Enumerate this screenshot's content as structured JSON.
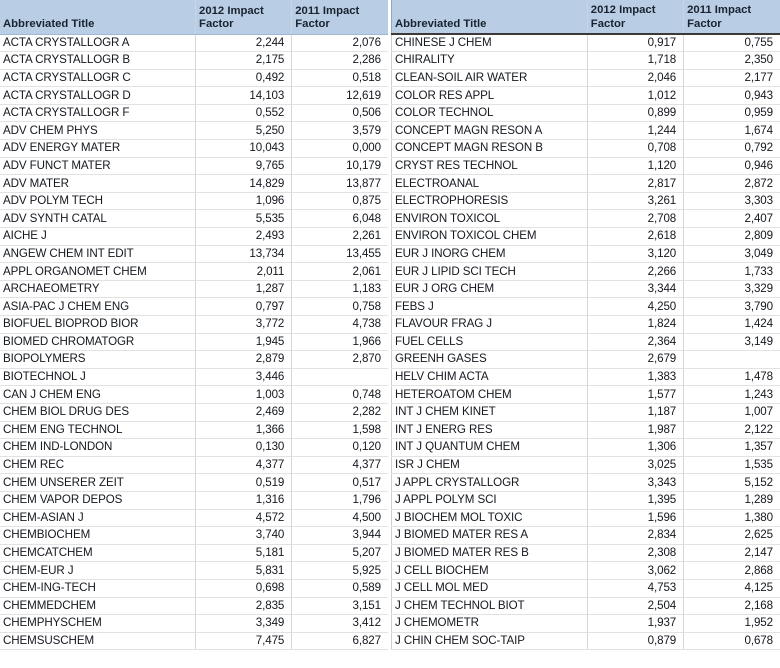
{
  "document": {
    "kind": "spreadsheet",
    "title": "Journal Impact Factor Table",
    "header_bg": "#b9cde4",
    "header_text_color": "#1a2330",
    "grid_line_color": "#d6d6d6",
    "decimal_separator": ","
  },
  "columns": {
    "title": "Abbreviated Title",
    "if2012": "2012 Impact\nFactor",
    "if2011": "2011 Impact\nFactor"
  },
  "left_table": {
    "rows": [
      {
        "title": "ACTA CRYSTALLOGR A",
        "if2012": "2,244",
        "if2011": "2,076"
      },
      {
        "title": "ACTA CRYSTALLOGR B",
        "if2012": "2,175",
        "if2011": "2,286"
      },
      {
        "title": "ACTA CRYSTALLOGR C",
        "if2012": "0,492",
        "if2011": "0,518"
      },
      {
        "title": "ACTA CRYSTALLOGR D",
        "if2012": "14,103",
        "if2011": "12,619"
      },
      {
        "title": "ACTA CRYSTALLOGR F",
        "if2012": "0,552",
        "if2011": "0,506"
      },
      {
        "title": "ADV CHEM PHYS",
        "if2012": "5,250",
        "if2011": "3,579"
      },
      {
        "title": "ADV ENERGY MATER",
        "if2012": "10,043",
        "if2011": "0,000"
      },
      {
        "title": "ADV FUNCT MATER",
        "if2012": "9,765",
        "if2011": "10,179"
      },
      {
        "title": "ADV MATER",
        "if2012": "14,829",
        "if2011": "13,877"
      },
      {
        "title": "ADV POLYM TECH",
        "if2012": "1,096",
        "if2011": "0,875"
      },
      {
        "title": "ADV SYNTH CATAL",
        "if2012": "5,535",
        "if2011": "6,048"
      },
      {
        "title": "AICHE J",
        "if2012": "2,493",
        "if2011": "2,261"
      },
      {
        "title": "ANGEW CHEM INT EDIT",
        "if2012": "13,734",
        "if2011": "13,455"
      },
      {
        "title": "APPL ORGANOMET CHEM",
        "if2012": "2,011",
        "if2011": "2,061"
      },
      {
        "title": "ARCHAEOMETRY",
        "if2012": "1,287",
        "if2011": "1,183"
      },
      {
        "title": "ASIA-PAC J CHEM ENG",
        "if2012": "0,797",
        "if2011": "0,758"
      },
      {
        "title": "BIOFUEL BIOPROD BIOR",
        "if2012": "3,772",
        "if2011": "4,738"
      },
      {
        "title": "BIOMED CHROMATOGR",
        "if2012": "1,945",
        "if2011": "1,966"
      },
      {
        "title": "BIOPOLYMERS",
        "if2012": "2,879",
        "if2011": "2,870"
      },
      {
        "title": "BIOTECHNOL J",
        "if2012": "3,446",
        "if2011": ""
      },
      {
        "title": "CAN J CHEM ENG",
        "if2012": "1,003",
        "if2011": "0,748"
      },
      {
        "title": "CHEM BIOL DRUG DES",
        "if2012": "2,469",
        "if2011": "2,282"
      },
      {
        "title": "CHEM ENG TECHNOL",
        "if2012": "1,366",
        "if2011": "1,598"
      },
      {
        "title": "CHEM IND-LONDON",
        "if2012": "0,130",
        "if2011": "0,120"
      },
      {
        "title": "CHEM REC",
        "if2012": "4,377",
        "if2011": "4,377"
      },
      {
        "title": "CHEM UNSERER ZEIT",
        "if2012": "0,519",
        "if2011": "0,517"
      },
      {
        "title": "CHEM VAPOR DEPOS",
        "if2012": "1,316",
        "if2011": "1,796"
      },
      {
        "title": "CHEM-ASIAN J",
        "if2012": "4,572",
        "if2011": "4,500"
      },
      {
        "title": "CHEMBIOCHEM",
        "if2012": "3,740",
        "if2011": "3,944"
      },
      {
        "title": "CHEMCATCHEM",
        "if2012": "5,181",
        "if2011": "5,207"
      },
      {
        "title": "CHEM-EUR J",
        "if2012": "5,831",
        "if2011": "5,925"
      },
      {
        "title": "CHEM-ING-TECH",
        "if2012": "0,698",
        "if2011": "0,589"
      },
      {
        "title": "CHEMMEDCHEM",
        "if2012": "2,835",
        "if2011": "3,151"
      },
      {
        "title": "CHEMPHYSCHEM",
        "if2012": "3,349",
        "if2011": "3,412"
      },
      {
        "title": "CHEMSUSCHEM",
        "if2012": "7,475",
        "if2011": "6,827"
      }
    ]
  },
  "right_table": {
    "rows": [
      {
        "title": "CHINESE J CHEM",
        "if2012": "0,917",
        "if2011": "0,755"
      },
      {
        "title": "CHIRALITY",
        "if2012": "1,718",
        "if2011": "2,350"
      },
      {
        "title": "CLEAN-SOIL AIR WATER",
        "if2012": "2,046",
        "if2011": "2,177"
      },
      {
        "title": "COLOR RES APPL",
        "if2012": "1,012",
        "if2011": "0,943"
      },
      {
        "title": "COLOR TECHNOL",
        "if2012": "0,899",
        "if2011": "0,959"
      },
      {
        "title": "CONCEPT MAGN RESON A",
        "if2012": "1,244",
        "if2011": "1,674"
      },
      {
        "title": "CONCEPT MAGN RESON B",
        "if2012": "0,708",
        "if2011": "0,792"
      },
      {
        "title": "CRYST RES TECHNOL",
        "if2012": "1,120",
        "if2011": "0,946"
      },
      {
        "title": "ELECTROANAL",
        "if2012": "2,817",
        "if2011": "2,872"
      },
      {
        "title": "ELECTROPHORESIS",
        "if2012": "3,261",
        "if2011": "3,303"
      },
      {
        "title": "ENVIRON TOXICOL",
        "if2012": "2,708",
        "if2011": "2,407"
      },
      {
        "title": "ENVIRON TOXICOL CHEM",
        "if2012": "2,618",
        "if2011": "2,809"
      },
      {
        "title": "EUR J INORG CHEM",
        "if2012": "3,120",
        "if2011": "3,049"
      },
      {
        "title": "EUR J LIPID SCI TECH",
        "if2012": "2,266",
        "if2011": "1,733"
      },
      {
        "title": "EUR J ORG CHEM",
        "if2012": "3,344",
        "if2011": "3,329"
      },
      {
        "title": "FEBS J",
        "if2012": "4,250",
        "if2011": "3,790"
      },
      {
        "title": "FLAVOUR FRAG J",
        "if2012": "1,824",
        "if2011": "1,424"
      },
      {
        "title": "FUEL CELLS",
        "if2012": "2,364",
        "if2011": "3,149"
      },
      {
        "title": "GREENH GASES",
        "if2012": "2,679",
        "if2011": ""
      },
      {
        "title": "HELV CHIM ACTA",
        "if2012": "1,383",
        "if2011": "1,478"
      },
      {
        "title": "HETEROATOM CHEM",
        "if2012": "1,577",
        "if2011": "1,243"
      },
      {
        "title": "INT J CHEM KINET",
        "if2012": "1,187",
        "if2011": "1,007"
      },
      {
        "title": "INT J ENERG RES",
        "if2012": "1,987",
        "if2011": "2,122"
      },
      {
        "title": "INT J QUANTUM CHEM",
        "if2012": "1,306",
        "if2011": "1,357"
      },
      {
        "title": "ISR J CHEM",
        "if2012": "3,025",
        "if2011": "1,535"
      },
      {
        "title": "J APPL CRYSTALLOGR",
        "if2012": "3,343",
        "if2011": "5,152"
      },
      {
        "title": "J APPL POLYM SCI",
        "if2012": "1,395",
        "if2011": "1,289"
      },
      {
        "title": "J BIOCHEM MOL TOXIC",
        "if2012": "1,596",
        "if2011": "1,380"
      },
      {
        "title": "J BIOMED MATER RES A",
        "if2012": "2,834",
        "if2011": "2,625"
      },
      {
        "title": "J BIOMED MATER RES B",
        "if2012": "2,308",
        "if2011": "2,147"
      },
      {
        "title": "J CELL BIOCHEM",
        "if2012": "3,062",
        "if2011": "2,868"
      },
      {
        "title": "J CELL MOL MED",
        "if2012": "4,753",
        "if2011": "4,125"
      },
      {
        "title": "J CHEM TECHNOL BIOT",
        "if2012": "2,504",
        "if2011": "2,168"
      },
      {
        "title": "J CHEMOMETR",
        "if2012": "1,937",
        "if2011": "1,952"
      },
      {
        "title": "J CHIN CHEM SOC-TAIP",
        "if2012": "0,879",
        "if2011": "0,678"
      }
    ]
  }
}
